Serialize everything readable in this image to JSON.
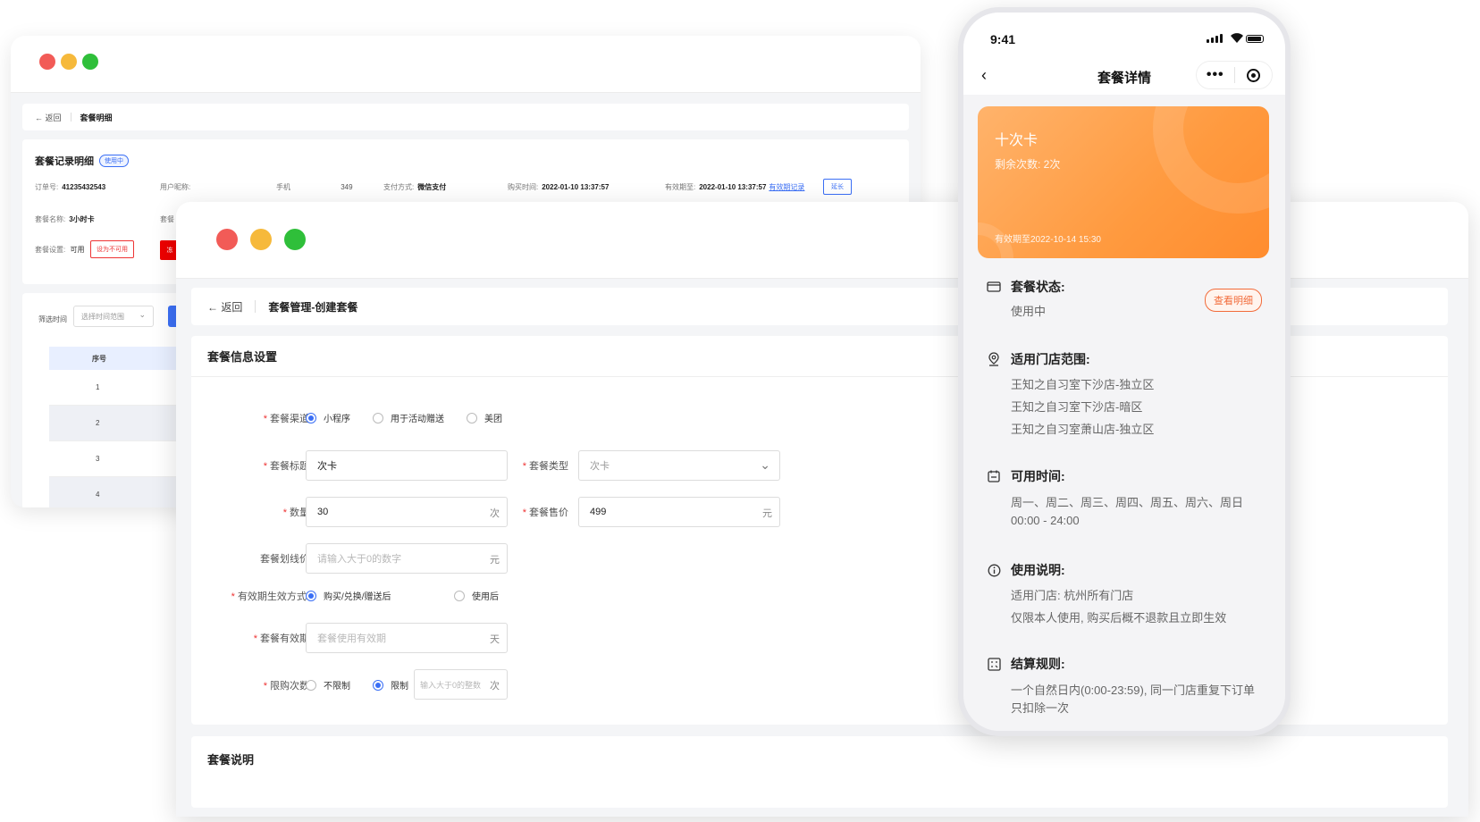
{
  "back_window": {
    "traffic_lights": {
      "red": "#f25b57",
      "yellow": "#f6b93b",
      "green": "#2fbf3a"
    },
    "breadcrumb": {
      "back": "← 返回",
      "title": "套餐明细"
    },
    "record": {
      "title": "套餐记录明细",
      "status_badge": "使用中",
      "order_no_label": "订单号:",
      "order_no": "41235432543",
      "nickname_label": "用户昵称:",
      "phone_label": "手机",
      "phone_value": "349",
      "pay_label": "支付方式:",
      "pay_value": "微信支付",
      "buy_time_label": "购买时间:",
      "buy_time": "2022-01-10 13:37:57",
      "valid_label": "有效期至:",
      "valid_value": "2022-01-10 13:37:57",
      "valid_link": "有效期记录",
      "extend_button": "延长",
      "name_label": "套餐名称:",
      "name_value": "3小时卡",
      "type_label": "套餐",
      "setting_label": "套餐设置:",
      "setting_value": "可用",
      "set_unavailable_button": "设为不可用",
      "freeze_button": "冻"
    },
    "filter": {
      "label": "筛选时间",
      "placeholder": "选择时间范围"
    },
    "table": {
      "header": "序号",
      "rows": [
        "1",
        "2",
        "3",
        "4"
      ]
    }
  },
  "front_window": {
    "traffic_lights": {
      "red": "#f25b57",
      "yellow": "#f6b93b",
      "green": "#2fbf3a"
    },
    "breadcrumb": {
      "back": "返回",
      "title": "套餐管理-创建套餐"
    },
    "form": {
      "section_title": "套餐信息设置",
      "channel": {
        "label": "套餐渠道",
        "options": [
          "小程序",
          "用于活动赠送",
          "美团"
        ],
        "selected": "小程序"
      },
      "title": {
        "label": "套餐标题",
        "value": "次卡"
      },
      "type": {
        "label": "套餐类型",
        "value": "次卡"
      },
      "quantity": {
        "label": "数量",
        "value": "30",
        "unit": "次"
      },
      "price": {
        "label": "套餐售价",
        "value": "499",
        "unit": "元"
      },
      "strike_price": {
        "label": "套餐划线价",
        "placeholder": "请输入大于0的数字",
        "unit": "元"
      },
      "effective_mode": {
        "label": "有效期生效方式:",
        "options": [
          "购买/兑换/赠送后",
          "使用后"
        ],
        "selected": "购买/兑换/赠送后"
      },
      "validity": {
        "label": "套餐有效期",
        "placeholder": "套餐使用有效期",
        "unit": "天"
      },
      "purchase_limit": {
        "label": "限购次数",
        "options": [
          "不限制",
          "限制"
        ],
        "selected": "限制",
        "placeholder": "输入大于0的整数",
        "unit": "次"
      }
    },
    "description_title": "套餐说明"
  },
  "phone": {
    "time": "9:41",
    "nav_title": "套餐详情",
    "more_glyph": "•••",
    "card": {
      "name": "十次卡",
      "remaining": "剩余次数: 2次",
      "valid_until": "有效期至2022-10-14 15:30"
    },
    "status": {
      "title": "套餐状态:",
      "value": "使用中",
      "detail_button": "查看明细"
    },
    "stores": {
      "title": "适用门店范围:",
      "items": [
        "王知之自习室下沙店-独立区",
        "王知之自习室下沙店-暗区",
        "王知之自习室萧山店-独立区"
      ]
    },
    "time_avail": {
      "title": "可用时间:",
      "days": "周一、周二、周三、周四、周五、周六、周日",
      "hours": "00:00 - 24:00"
    },
    "usage": {
      "title": "使用说明:",
      "lines": [
        "适用门店: 杭州所有门店",
        "仅限本人使用, 购买后概不退款且立即生效"
      ]
    },
    "settle": {
      "title": "结算规则:",
      "lines": [
        "一个自然日内(0:00-23:59), 同一门店重复下订单",
        "只扣除一次"
      ]
    },
    "accent": "#ff9a3f"
  }
}
